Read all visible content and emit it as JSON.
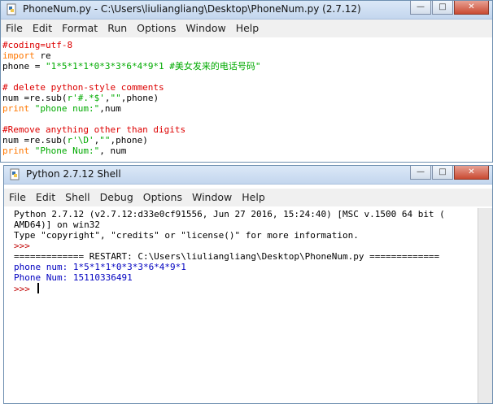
{
  "editor": {
    "title": "PhoneNum.py - C:\\Users\\liuliangliang\\Desktop\\PhoneNum.py (2.7.12)",
    "menu": [
      "File",
      "Edit",
      "Format",
      "Run",
      "Options",
      "Window",
      "Help"
    ],
    "lines": [
      {
        "parts": [
          {
            "t": "#coding=utf-8",
            "c": "c-comment"
          }
        ]
      },
      {
        "parts": [
          {
            "t": "import",
            "c": "c-kw"
          },
          {
            "t": " re",
            "c": "c-plain"
          }
        ]
      },
      {
        "parts": [
          {
            "t": "phone = ",
            "c": "c-plain"
          },
          {
            "t": "\"1*5*1*1*0*3*3*6*4*9*1 #美女发来的电话号码\"",
            "c": "c-str"
          }
        ]
      },
      {
        "parts": [
          {
            "t": "",
            "c": "c-plain"
          }
        ]
      },
      {
        "parts": [
          {
            "t": "# delete python-style comments",
            "c": "c-comment"
          }
        ]
      },
      {
        "parts": [
          {
            "t": "num =re.sub(",
            "c": "c-plain"
          },
          {
            "t": "r'#.*$'",
            "c": "c-str"
          },
          {
            "t": ",",
            "c": "c-plain"
          },
          {
            "t": "\"\"",
            "c": "c-str"
          },
          {
            "t": ",phone)",
            "c": "c-plain"
          }
        ]
      },
      {
        "parts": [
          {
            "t": "print",
            "c": "c-kw"
          },
          {
            "t": " ",
            "c": "c-plain"
          },
          {
            "t": "\"phone num:\"",
            "c": "c-str"
          },
          {
            "t": ",num",
            "c": "c-plain"
          }
        ]
      },
      {
        "parts": [
          {
            "t": "",
            "c": "c-plain"
          }
        ]
      },
      {
        "parts": [
          {
            "t": "#Remove anything other than digits",
            "c": "c-comment"
          }
        ]
      },
      {
        "parts": [
          {
            "t": "num =re.sub(",
            "c": "c-plain"
          },
          {
            "t": "r'\\D'",
            "c": "c-str"
          },
          {
            "t": ",",
            "c": "c-plain"
          },
          {
            "t": "\"\"",
            "c": "c-str"
          },
          {
            "t": ",phone)",
            "c": "c-plain"
          }
        ]
      },
      {
        "parts": [
          {
            "t": "print",
            "c": "c-kw"
          },
          {
            "t": " ",
            "c": "c-plain"
          },
          {
            "t": "\"Phone Num:\"",
            "c": "c-str"
          },
          {
            "t": ", num",
            "c": "c-plain"
          }
        ]
      }
    ]
  },
  "shell": {
    "title": "Python 2.7.12 Shell",
    "menu": [
      "File",
      "Edit",
      "Shell",
      "Debug",
      "Options",
      "Window",
      "Help"
    ],
    "lines": [
      {
        "parts": [
          {
            "t": "Python 2.7.12 (v2.7.12:d33e0cf91556, Jun 27 2016, 15:24:40) [MSC v.1500 64 bit (",
            "c": "c-plain"
          }
        ]
      },
      {
        "parts": [
          {
            "t": "AMD64)] on win32",
            "c": "c-plain"
          }
        ]
      },
      {
        "parts": [
          {
            "t": "Type \"copyright\", \"credits\" or \"license()\" for more information.",
            "c": "c-plain"
          }
        ]
      },
      {
        "parts": [
          {
            "t": ">>> ",
            "c": "c-prompt"
          }
        ]
      },
      {
        "parts": [
          {
            "t": "============= RESTART: C:\\Users\\liuliangliang\\Desktop\\PhoneNum.py =============",
            "c": "c-plain"
          }
        ]
      },
      {
        "parts": [
          {
            "t": "phone num: 1*5*1*1*0*3*3*6*4*9*1",
            "c": "c-out"
          }
        ]
      },
      {
        "parts": [
          {
            "t": "Phone Num: 15110336491",
            "c": "c-out"
          }
        ]
      }
    ],
    "prompt": ">>> "
  },
  "controls": {
    "minimize": "—",
    "maximize": "□",
    "close": "✕"
  }
}
